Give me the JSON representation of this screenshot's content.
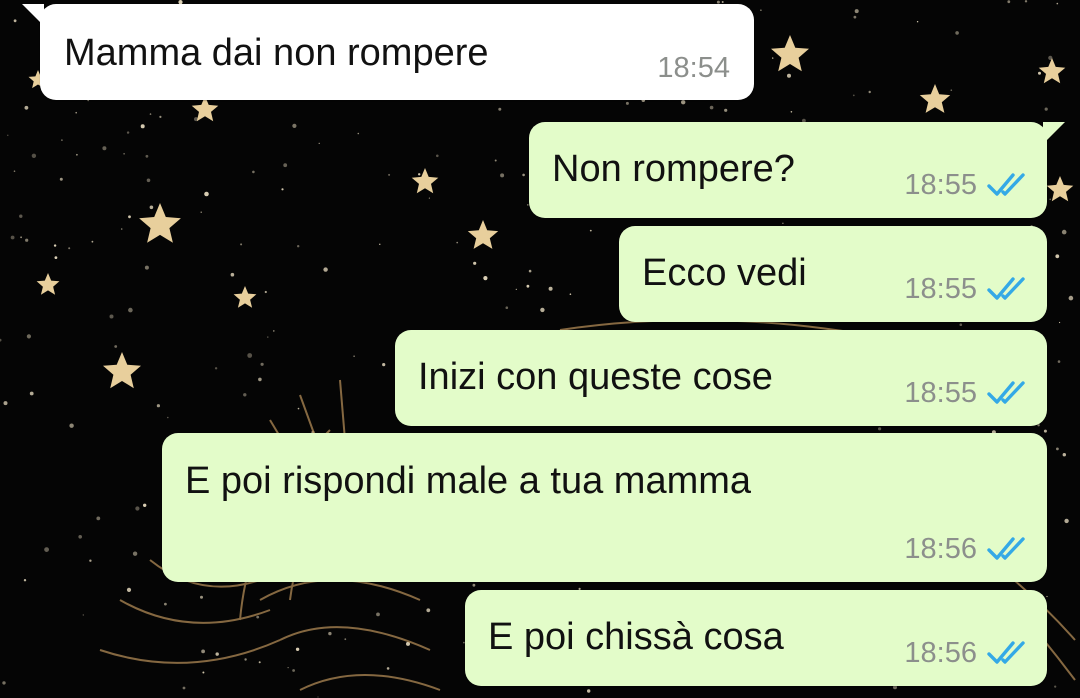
{
  "chat": {
    "messages": [
      {
        "direction": "incoming",
        "text": "Mamma dai non rompere",
        "time": "18:54",
        "status_icon": ""
      },
      {
        "direction": "outgoing",
        "text": "Non rompere?",
        "time": "18:55",
        "status_icon": "double-check-read-icon"
      },
      {
        "direction": "outgoing",
        "text": "Ecco vedi",
        "time": "18:55",
        "status_icon": "double-check-read-icon"
      },
      {
        "direction": "outgoing",
        "text": "Inizi con queste cose",
        "time": "18:55",
        "status_icon": "double-check-read-icon"
      },
      {
        "direction": "outgoing",
        "text": "E poi rispondi male a tua mamma",
        "time": "18:56",
        "status_icon": "double-check-read-icon"
      },
      {
        "direction": "outgoing",
        "text": "E poi chissà cosa",
        "time": "18:56",
        "status_icon": "double-check-read-icon"
      }
    ]
  },
  "colors": {
    "incoming_bubble": "#ffffff",
    "outgoing_bubble": "#e3fcc9",
    "read_tick": "#34a9e6",
    "background": "#050505",
    "star": "#e8cf9c",
    "line_art": "#b08a55"
  }
}
